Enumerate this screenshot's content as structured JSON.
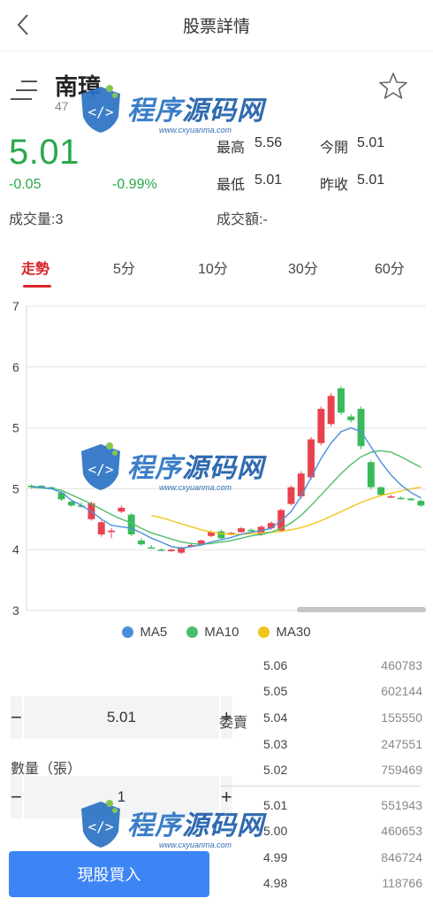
{
  "header": {
    "title": "股票詳情"
  },
  "stock": {
    "name": "南璋",
    "code": "47",
    "price": "5.01",
    "change": "-0.05",
    "change_pct": "-0.99%",
    "high_label": "最高",
    "high_value": "5.56",
    "open_label": "今開",
    "open_value": "5.01",
    "low_label": "最低",
    "low_value": "5.01",
    "prev_close_label": "昨收",
    "prev_close_value": "5.01",
    "volume": "成交量:3",
    "turnover": "成交額:-"
  },
  "tabs": [
    "走勢",
    "5分",
    "10分",
    "30分",
    "60分"
  ],
  "active_tab": 0,
  "chart_data": {
    "type": "candlestick",
    "yaxis_ticks": [
      "7",
      "6",
      "5",
      "5",
      "4",
      "3"
    ],
    "ylim": [
      3,
      7
    ],
    "grid": true,
    "colors": {
      "up": "#e8424f",
      "down": "#3aba5a",
      "ma5": "#4a90d9",
      "ma10": "#4cbf6b",
      "ma30": "#f0c419"
    },
    "candles": [
      {
        "o": 4.64,
        "c": 4.62,
        "h": 4.66,
        "l": 4.6
      },
      {
        "o": 4.64,
        "c": 4.63,
        "h": 4.65,
        "l": 4.61
      },
      {
        "o": 4.62,
        "c": 4.6,
        "h": 4.63,
        "l": 4.59
      },
      {
        "o": 4.55,
        "c": 4.46,
        "h": 4.57,
        "l": 4.44
      },
      {
        "o": 4.43,
        "c": 4.38,
        "h": 4.44,
        "l": 4.36
      },
      {
        "o": 4.38,
        "c": 4.37,
        "h": 4.42,
        "l": 4.35
      },
      {
        "o": 4.2,
        "c": 4.41,
        "h": 4.43,
        "l": 4.18
      },
      {
        "o": 4.0,
        "c": 4.16,
        "h": 4.18,
        "l": 3.97
      },
      {
        "o": 4.03,
        "c": 4.05,
        "h": 4.08,
        "l": 3.95
      },
      {
        "o": 4.3,
        "c": 4.35,
        "h": 4.38,
        "l": 4.28
      },
      {
        "o": 4.26,
        "c": 4.0,
        "h": 4.28,
        "l": 3.98
      },
      {
        "o": 3.92,
        "c": 3.87,
        "h": 3.95,
        "l": 3.85
      },
      {
        "o": 3.83,
        "c": 3.82,
        "h": 3.86,
        "l": 3.81
      },
      {
        "o": 3.8,
        "c": 3.79,
        "h": 3.82,
        "l": 3.78
      },
      {
        "o": 3.78,
        "c": 3.8,
        "h": 3.81,
        "l": 3.77
      },
      {
        "o": 3.76,
        "c": 3.82,
        "h": 3.84,
        "l": 3.74
      },
      {
        "o": 3.85,
        "c": 3.86,
        "h": 3.88,
        "l": 3.84
      },
      {
        "o": 3.86,
        "c": 3.92,
        "h": 3.93,
        "l": 3.85
      },
      {
        "o": 3.98,
        "c": 4.03,
        "h": 4.05,
        "l": 3.96
      },
      {
        "o": 4.04,
        "c": 3.95,
        "h": 4.06,
        "l": 3.93
      },
      {
        "o": 4.0,
        "c": 4.02,
        "h": 4.03,
        "l": 3.99
      },
      {
        "o": 4.03,
        "c": 4.08,
        "h": 4.1,
        "l": 4.02
      },
      {
        "o": 4.06,
        "c": 4.05,
        "h": 4.08,
        "l": 4.04
      },
      {
        "o": 4.0,
        "c": 4.1,
        "h": 4.12,
        "l": 3.98
      },
      {
        "o": 4.08,
        "c": 4.15,
        "h": 4.17,
        "l": 4.06
      },
      {
        "o": 4.05,
        "c": 4.32,
        "h": 4.34,
        "l": 4.03
      },
      {
        "o": 4.4,
        "c": 4.62,
        "h": 4.64,
        "l": 4.38
      },
      {
        "o": 4.5,
        "c": 4.8,
        "h": 4.83,
        "l": 4.47
      },
      {
        "o": 4.75,
        "c": 5.25,
        "h": 5.28,
        "l": 4.72
      },
      {
        "o": 5.2,
        "c": 5.65,
        "h": 5.68,
        "l": 5.17
      },
      {
        "o": 5.45,
        "c": 5.82,
        "h": 5.86,
        "l": 5.42
      },
      {
        "o": 5.92,
        "c": 5.6,
        "h": 5.95,
        "l": 5.57
      },
      {
        "o": 5.55,
        "c": 5.5,
        "h": 5.58,
        "l": 5.47
      },
      {
        "o": 5.65,
        "c": 5.16,
        "h": 5.68,
        "l": 5.12
      },
      {
        "o": 4.95,
        "c": 4.62,
        "h": 4.98,
        "l": 4.59
      },
      {
        "o": 4.62,
        "c": 4.52,
        "h": 4.63,
        "l": 4.5
      },
      {
        "o": 4.5,
        "c": 4.5,
        "h": 4.52,
        "l": 4.48
      },
      {
        "o": 4.48,
        "c": 4.47,
        "h": 4.5,
        "l": 4.46
      },
      {
        "o": 4.47,
        "c": 4.45,
        "h": 4.48,
        "l": 4.44
      },
      {
        "o": 4.44,
        "c": 4.38,
        "h": 4.46,
        "l": 4.36
      }
    ],
    "ma5": [
      4.63,
      4.62,
      4.6,
      4.55,
      4.45,
      4.38,
      4.3,
      4.2,
      4.12,
      4.1,
      4.08,
      4.02,
      3.95,
      3.9,
      3.84,
      3.82,
      3.84,
      3.86,
      3.9,
      3.93,
      3.96,
      4.0,
      4.03,
      4.05,
      4.08,
      4.18,
      4.3,
      4.5,
      4.75,
      5.0,
      5.2,
      5.35,
      5.4,
      5.35,
      5.15,
      4.95,
      4.78,
      4.65,
      4.55,
      4.48
    ],
    "ma10": [
      4.62,
      4.61,
      4.6,
      4.58,
      4.52,
      4.46,
      4.4,
      4.33,
      4.26,
      4.2,
      4.15,
      4.08,
      4.02,
      3.98,
      3.94,
      3.9,
      3.88,
      3.87,
      3.88,
      3.9,
      3.92,
      3.95,
      3.98,
      4.0,
      4.03,
      4.08,
      4.15,
      4.25,
      4.38,
      4.52,
      4.66,
      4.8,
      4.92,
      5.02,
      5.08,
      5.1,
      5.08,
      5.02,
      4.95,
      4.88
    ],
    "ma30": [
      null,
      null,
      null,
      null,
      null,
      null,
      null,
      null,
      null,
      null,
      null,
      null,
      4.25,
      4.22,
      4.18,
      4.14,
      4.1,
      4.06,
      4.03,
      4.01,
      4.0,
      4.0,
      4.01,
      4.02,
      4.03,
      4.04,
      4.06,
      4.09,
      4.13,
      4.18,
      4.24,
      4.3,
      4.36,
      4.42,
      4.47,
      4.51,
      4.54,
      4.57,
      4.6,
      4.62
    ]
  },
  "legend": [
    "MA5",
    "MA10",
    "MA30"
  ],
  "trade": {
    "price_minus": "−",
    "price_value": "5.01",
    "price_plus": "+",
    "qty_label": "數量（張）",
    "qty_minus": "−",
    "qty_value": "1",
    "qty_plus": "+",
    "buy_label": "現股買入"
  },
  "orderbook": {
    "label": "委賣",
    "asks": [
      {
        "price": "5.06",
        "vol": "460783"
      },
      {
        "price": "5.05",
        "vol": "602144"
      },
      {
        "price": "5.04",
        "vol": "155550"
      },
      {
        "price": "5.03",
        "vol": "247551"
      },
      {
        "price": "5.02",
        "vol": "759469"
      }
    ],
    "bids": [
      {
        "price": "5.01",
        "vol": "551943"
      },
      {
        "price": "5.00",
        "vol": "460653"
      },
      {
        "price": "4.99",
        "vol": "846724"
      },
      {
        "price": "4.98",
        "vol": "118766"
      }
    ]
  },
  "watermark": {
    "text_a": "程序",
    "text_b": "源码网",
    "url": "www.cxyuanma.com"
  }
}
